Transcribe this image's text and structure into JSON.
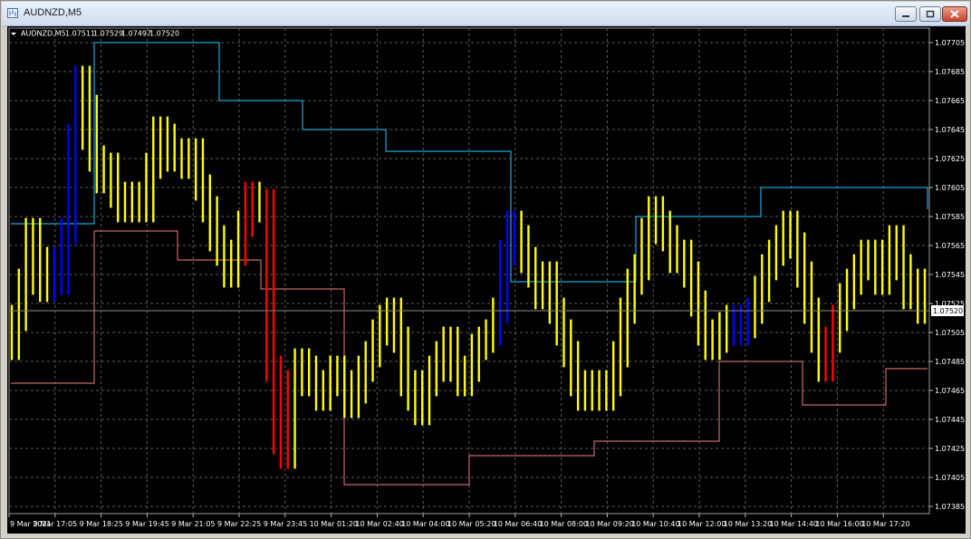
{
  "window": {
    "title": "AUDNZD,M5"
  },
  "chart_info": {
    "symbol": "AUDNZD,M5",
    "ohlc": [
      "1.07511",
      "1.07529",
      "1.07497",
      "1.07520"
    ]
  },
  "chart_data": {
    "type": "line",
    "title": "",
    "xlabel": "",
    "ylabel": "",
    "ylim": [
      1.0738,
      1.07715
    ],
    "grid": true,
    "current_price": "1.07520",
    "yticks": [
      "1.07705",
      "1.07685",
      "1.07665",
      "1.07645",
      "1.07625",
      "1.07605",
      "1.07585",
      "1.07565",
      "1.07545",
      "1.07525",
      "1.07505",
      "1.07485",
      "1.07465",
      "1.07445",
      "1.07425",
      "1.07405",
      "1.07385"
    ],
    "x": [
      "9 Mar 2021",
      "9 Mar 17:05",
      "9 Mar 18:25",
      "9 Mar 19:45",
      "9 Mar 21:05",
      "9 Mar 22:25",
      "9 Mar 23:45",
      "10 Mar 01:20",
      "10 Mar 02:40",
      "10 Mar 04:00",
      "10 Mar 05:20",
      "10 Mar 06:40",
      "10 Mar 08:00",
      "10 Mar 09:20",
      "10 Mar 10:40",
      "10 Mar 12:00",
      "10 Mar 13:20",
      "10 Mar 14:40",
      "10 Mar 16:00",
      "10 Mar 17:20"
    ],
    "colors": {
      "price": "#ffff00",
      "up": "#0000ff",
      "down": "#ff0000",
      "upper_band": "#1ea7d8",
      "lower_band": "#c56a6a",
      "grid": "#5a5a5a",
      "axis_text": "#ffffff"
    },
    "series": [
      {
        "values": [
          1.07495,
          1.07515,
          1.0754,
          1.07575,
          1.07555,
          1.07535,
          1.07555,
          1.0754,
          1.07575,
          1.0764,
          1.0768,
          1.0766,
          1.07625,
          1.0761,
          1.0762,
          1.076,
          1.0759,
          1.076,
          1.07595,
          1.0759,
          1.0762,
          1.07645,
          1.0764,
          1.07625,
          1.0763,
          1.0762,
          1.0763,
          1.07605,
          1.0759,
          1.0757,
          1.0756,
          1.07545,
          1.0756,
          1.0758,
          1.076,
          1.0759,
          1.07595,
          1.0748,
          1.0743,
          1.0742,
          1.0747,
          1.07485,
          1.0748,
          1.0747,
          1.0746,
          1.0747,
          1.0748,
          1.0747,
          1.07455,
          1.07465,
          1.0748,
          1.0749,
          1.07505,
          1.07515,
          1.0752,
          1.075,
          1.0747,
          1.0746,
          1.0745,
          1.0747,
          1.0748,
          1.0749,
          1.075,
          1.0748,
          1.0747,
          1.0748,
          1.07495,
          1.075,
          1.07505,
          1.0752,
          1.0756,
          1.0758,
          1.0757,
          1.07555,
          1.07545,
          1.0753,
          1.07545,
          1.0752,
          1.07505,
          1.0749,
          1.0747,
          1.0746,
          1.07465,
          1.0747,
          1.0746,
          1.0747,
          1.0749,
          1.0752,
          1.0754,
          1.0755,
          1.07575,
          1.0759,
          1.0758,
          1.0757,
          1.07555,
          1.0756,
          1.07545,
          1.07525,
          1.07505,
          1.07495,
          1.075,
          1.0751,
          1.07515,
          1.07505,
          1.0751,
          1.0752,
          1.07535,
          1.0755,
          1.0756,
          1.0757,
          1.0758,
          1.07565,
          1.07545,
          1.0752,
          1.075,
          1.0748,
          1.075,
          1.07515,
          1.0753,
          1.0754,
          1.0755,
          1.0756,
          1.07555,
          1.0754,
          1.0756,
          1.0757,
          1.0755,
          1.0753,
          1.0754,
          1.0752
        ]
      }
    ],
    "upper_band": [
      1.0758,
      1.0758,
      1.07705,
      1.07705,
      1.07705,
      1.07665,
      1.07665,
      1.07645,
      1.07645,
      1.0763,
      1.0763,
      1.0763,
      1.0754,
      1.0754,
      1.0754,
      1.07585,
      1.07585,
      1.07585,
      1.07605,
      1.07605,
      1.07605,
      1.07605,
      1.0759
    ],
    "lower_band": [
      1.0747,
      1.0747,
      1.07575,
      1.07575,
      1.07555,
      1.07555,
      1.07535,
      1.07535,
      1.074,
      1.074,
      1.074,
      1.0742,
      1.0742,
      1.0742,
      1.0743,
      1.0743,
      1.0743,
      1.07485,
      1.07485,
      1.07455,
      1.07455,
      1.0748,
      1.0748
    ]
  }
}
